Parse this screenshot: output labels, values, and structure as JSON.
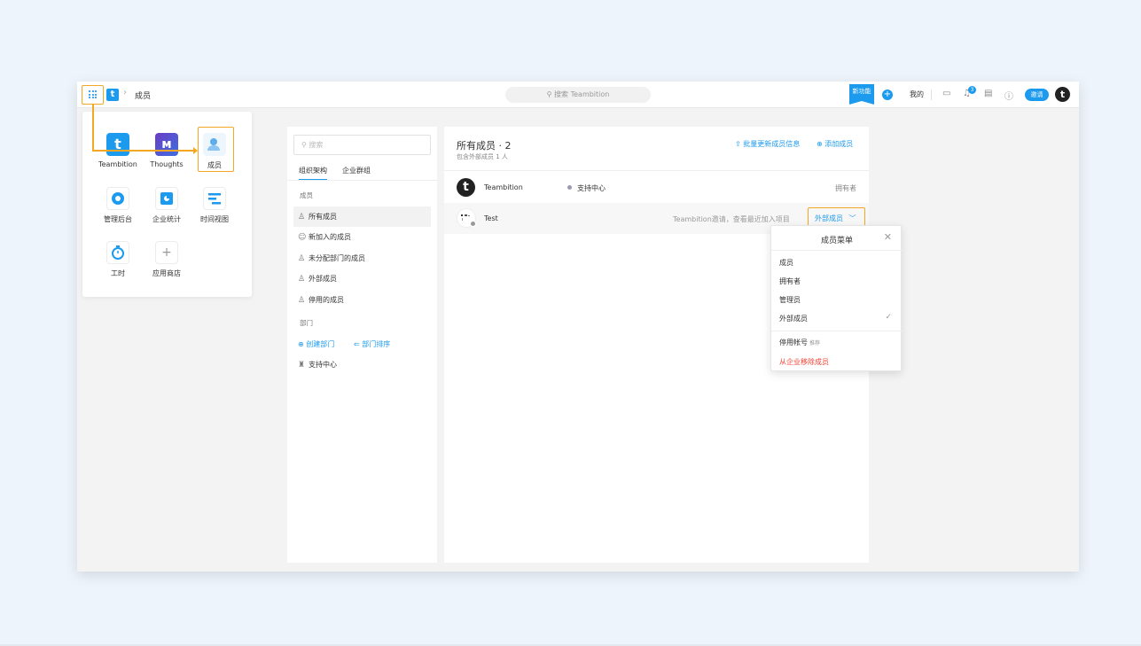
{
  "topbar": {
    "breadcrumb_label": "成员",
    "search_placeholder": "搜索 Teambition",
    "new_feature_badge": "新功能",
    "mine_label": "我的",
    "notification_count": "3",
    "invite_label": "邀请",
    "avatar_letter": "t"
  },
  "app_launcher": {
    "apps": [
      {
        "label": "Teambition",
        "icon": "teambition-icon"
      },
      {
        "label": "Thoughts",
        "icon": "thoughts-icon"
      },
      {
        "label": "成员",
        "icon": "members-icon"
      },
      {
        "label": "管理后台",
        "icon": "admin-icon"
      },
      {
        "label": "企业统计",
        "icon": "stats-icon"
      },
      {
        "label": "时间视图",
        "icon": "timeline-icon"
      },
      {
        "label": "工时",
        "icon": "timer-icon"
      },
      {
        "label": "应用商店",
        "icon": "add-icon"
      }
    ]
  },
  "left_panel": {
    "search_placeholder": "搜索",
    "tabs": [
      "组织架构",
      "企业群组"
    ],
    "members_section": "成员",
    "member_items": [
      "所有成员",
      "新加入的成员",
      "未分配部门的成员",
      "外部成员",
      "停用的成员"
    ],
    "dept_section": "部门",
    "create_dept": "创建部门",
    "sort_dept": "部门排序",
    "departments": [
      "支持中心"
    ]
  },
  "right_panel": {
    "title": "所有成员 · 2",
    "subtitle": "包含外部成员 1 人",
    "bulk_update": "批量更新成员信息",
    "add_member": "添加成员",
    "members": [
      {
        "name": "Teambition",
        "dept": "支持中心",
        "role": "拥有者"
      },
      {
        "name": "Test",
        "note": "Teambition邀请，查看最近加入项目",
        "role": "外部成员"
      }
    ]
  },
  "member_menu": {
    "title": "成员菜单",
    "roles": [
      "成员",
      "拥有者",
      "管理员",
      "外部成员"
    ],
    "selected_role": "外部成员",
    "disable_account": "停用帐号",
    "disable_note": "推荐",
    "remove": "从企业移除成员"
  },
  "colors": {
    "accent": "#1b9aee",
    "highlight": "#f5a623",
    "danger": "#f04134"
  }
}
